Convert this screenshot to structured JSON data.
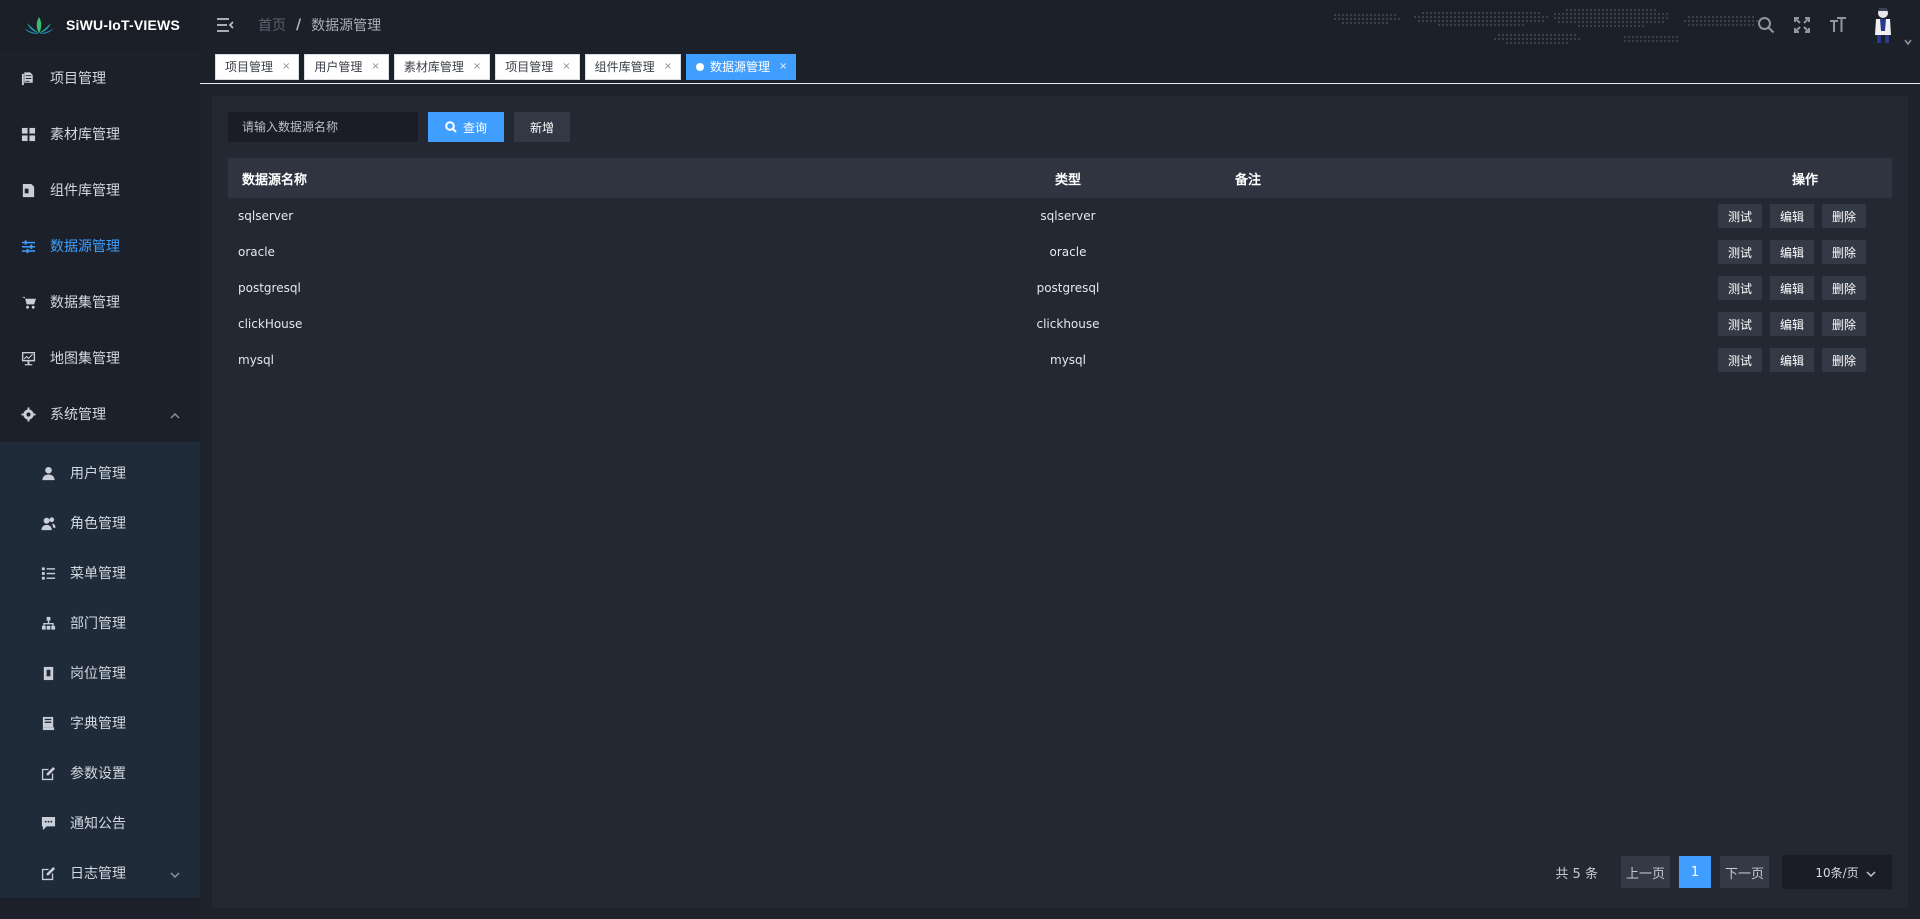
{
  "app": {
    "title": "SiWU-IoT-VIEWS"
  },
  "sidebar": {
    "items": [
      {
        "label": "项目管理",
        "icon": "copy-icon"
      },
      {
        "label": "素材库管理",
        "icon": "grid-icon"
      },
      {
        "label": "组件库管理",
        "icon": "document-icon"
      },
      {
        "label": "数据源管理",
        "icon": "sliders-icon",
        "active": true
      },
      {
        "label": "数据集管理",
        "icon": "cart-icon"
      },
      {
        "label": "地图集管理",
        "icon": "monitor-chart-icon"
      },
      {
        "label": "系统管理",
        "icon": "gear-icon",
        "expanded": true
      }
    ],
    "submenu": [
      {
        "label": "用户管理",
        "icon": "user-icon"
      },
      {
        "label": "角色管理",
        "icon": "users-icon"
      },
      {
        "label": "菜单管理",
        "icon": "list-icon"
      },
      {
        "label": "部门管理",
        "icon": "org-tree-icon"
      },
      {
        "label": "岗位管理",
        "icon": "badge-icon"
      },
      {
        "label": "字典管理",
        "icon": "book-icon"
      },
      {
        "label": "参数设置",
        "icon": "edit-icon"
      },
      {
        "label": "通知公告",
        "icon": "message-icon"
      },
      {
        "label": "日志管理",
        "icon": "log-icon"
      }
    ]
  },
  "header": {
    "breadcrumb": {
      "home": "首页",
      "separator": "/",
      "current": "数据源管理"
    }
  },
  "tags": [
    {
      "label": "项目管理",
      "close": "×"
    },
    {
      "label": "用户管理",
      "close": "×"
    },
    {
      "label": "素材库管理",
      "close": "×"
    },
    {
      "label": "项目管理",
      "close": "×"
    },
    {
      "label": "组件库管理",
      "close": "×"
    },
    {
      "label": "数据源管理",
      "close": "×",
      "active": true
    }
  ],
  "search": {
    "placeholder": "请输入数据源名称",
    "query_label": "查询",
    "add_label": "新增"
  },
  "table": {
    "headers": {
      "name": "数据源名称",
      "type": "类型",
      "remark": "备注",
      "ops": "操作"
    },
    "rows": [
      {
        "name": "sqlserver",
        "type": "sqlserver",
        "remark": ""
      },
      {
        "name": "oracle",
        "type": "oracle",
        "remark": ""
      },
      {
        "name": "postgresql",
        "type": "postgresql",
        "remark": ""
      },
      {
        "name": "clickHouse",
        "type": "clickhouse",
        "remark": ""
      },
      {
        "name": "mysql",
        "type": "mysql",
        "remark": ""
      }
    ],
    "actions": {
      "test": "测试",
      "edit": "编辑",
      "delete": "删除"
    }
  },
  "pagination": {
    "total_text": "共 5 条",
    "prev": "上一页",
    "current_page": "1",
    "next": "下一页",
    "page_size": "10条/页"
  },
  "colors": {
    "accent": "#409eff",
    "sidebar_bg": "#1c202a",
    "submenu_bg": "#1f2b38",
    "panel_bg": "#242833"
  }
}
